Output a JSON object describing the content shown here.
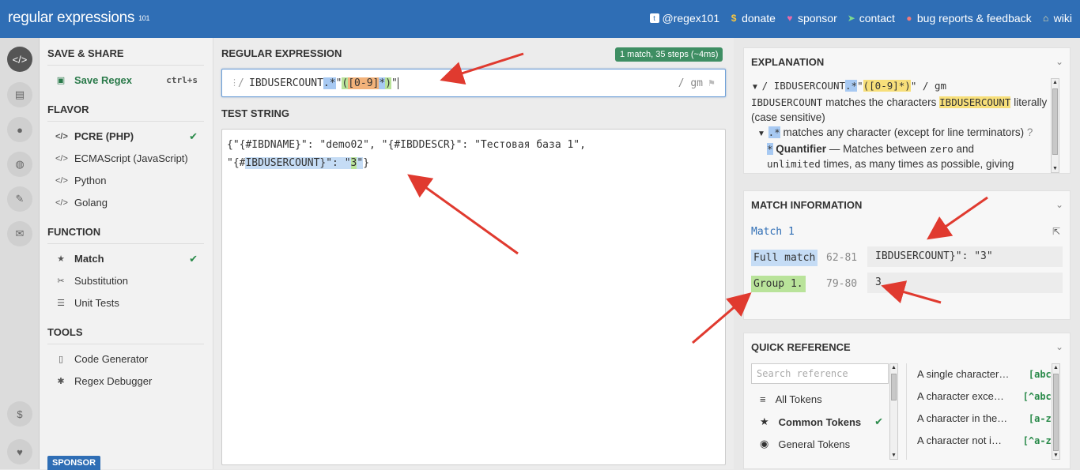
{
  "topbar": {
    "logo": "regular expressions",
    "logo_sup": "101",
    "links": [
      {
        "icon": "twitter-icon",
        "label": "@regex101"
      },
      {
        "icon": "dollar-icon",
        "label": "donate"
      },
      {
        "icon": "heart-icon",
        "label": "sponsor"
      },
      {
        "icon": "paper-plane-icon",
        "label": "contact"
      },
      {
        "icon": "bug-icon",
        "label": "bug reports & feedback"
      },
      {
        "icon": "bank-icon",
        "label": "wiki"
      }
    ]
  },
  "sidebar": {
    "save_share": "SAVE & SHARE",
    "save_regex": "Save Regex",
    "save_shortcut": "ctrl+s",
    "flavor": "FLAVOR",
    "flavors": [
      "PCRE (PHP)",
      "ECMAScript (JavaScript)",
      "Python",
      "Golang"
    ],
    "function": "FUNCTION",
    "functions": [
      "Match",
      "Substitution",
      "Unit Tests"
    ],
    "tools": "TOOLS",
    "tool_items": [
      "Code Generator",
      "Regex Debugger"
    ],
    "sponsor": "SPONSOR"
  },
  "main": {
    "regex_title": "REGULAR EXPRESSION",
    "match_badge": "1 match, 35 steps (~4ms)",
    "delimiter": "/",
    "regex_parts": [
      "IBDUSERCOUNT",
      ".*",
      "\"",
      "(",
      "[0-9]",
      "*",
      ")",
      "\""
    ],
    "flags": "/ gm",
    "test_title": "TEST STRING",
    "test_line1": "{\"{#IBDNAME}\": \"demo02\", \"{#IBDDESCR}\": \"Тестовая база 1\",",
    "test_line2_pre": "\"{#",
    "test_line2_match": "IBDUSERCOUNT}\": \"",
    "test_line2_group": "3",
    "test_line2_after": "\"",
    "test_line2_post": "}"
  },
  "explanation": {
    "title": "EXPLANATION",
    "line1_prefix": "/ IBDUSERCOUNT",
    "line1_dotstar": ".*",
    "line1_quote": "\"",
    "line1_group": "([0-9]*)",
    "line1_suffix": "\" / gm",
    "line2_code": "IBDUSERCOUNT",
    "line2_text": " matches the characters ",
    "line2_hl": "IBDUSERCOUNT",
    "line2_tail": " literally (case sensitive)",
    "line3_code": ".*",
    "line3_text": " matches any character (except for line terminators)",
    "line4_code": "*",
    "line4_bold": "Quantifier",
    "line4_text": " — Matches between ",
    "line4_zero": "zero",
    "line4_and": " and",
    "line5_code": "unlimited",
    "line5_text": " times, as many times as possible, giving"
  },
  "match_info": {
    "title": "MATCH INFORMATION",
    "match_label": "Match 1",
    "rows": [
      {
        "label": "Full match",
        "range": "62-81",
        "value": "IBDUSERCOUNT}\": \"3\""
      },
      {
        "label": "Group 1.",
        "range": "79-80",
        "value": "3"
      }
    ]
  },
  "quick_ref": {
    "title": "QUICK REFERENCE",
    "search_placeholder": "Search reference",
    "categories": [
      "All Tokens",
      "Common Tokens",
      "General Tokens"
    ],
    "refs": [
      {
        "text": "A single character…",
        "code": "[abc]"
      },
      {
        "text": "A character exce…",
        "code": "[^abc]"
      },
      {
        "text": "A character in the…",
        "code": "[a-z]"
      },
      {
        "text": "A character not i…",
        "code": "[^a-z]"
      }
    ]
  },
  "colors": {
    "brand": "#2f6eb5",
    "badge": "#3e8e63",
    "check": "#2a8a4a",
    "arrow": "#e03a2f"
  }
}
